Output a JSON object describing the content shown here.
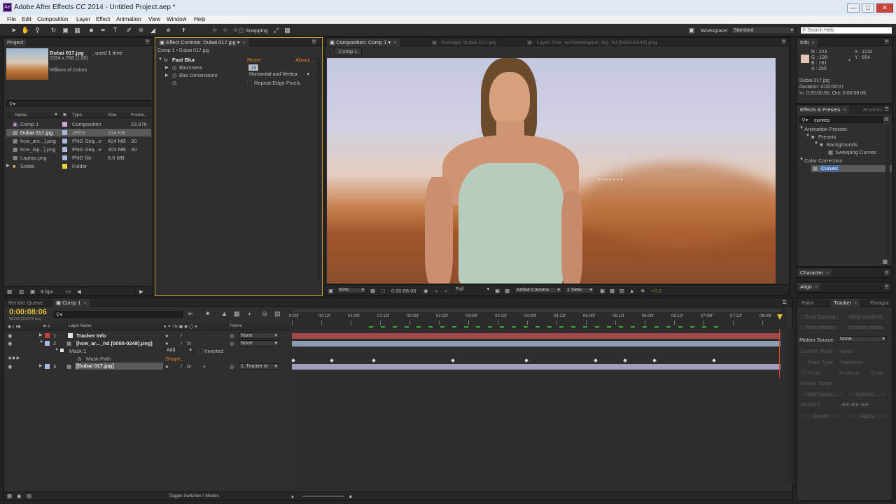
{
  "window": {
    "title": "Adobe After Effects CC 2014 - Untitled Project.aep *",
    "minimize": "—",
    "maximize": "□",
    "close": "✕"
  },
  "menu": [
    "File",
    "Edit",
    "Composition",
    "Layer",
    "Effect",
    "Animation",
    "View",
    "Window",
    "Help"
  ],
  "toolbar": {
    "snapping": "Snapping",
    "workspace_label": "Workspace:",
    "workspace_value": "Standard",
    "search_placeholder": "Search Help"
  },
  "project": {
    "tab": "Project",
    "selected_name": "Dubai 017.jpg",
    "selected_used": ", used 1 time",
    "selected_dims": "1024 x 768 (1.00)",
    "selected_colors": "Millions of Colors",
    "columns": [
      "Name",
      "Type",
      "Size",
      "Frame..."
    ],
    "items": [
      {
        "name": "Comp 1",
        "type": "Composition",
        "size": "",
        "frame": "23.976"
      },
      {
        "name": "Dubai 017.jpg",
        "type": "JPEG",
        "size": "134 KB",
        "frame": ""
      },
      {
        "name": "hcw_arc...].png",
        "type": "PNG Seq...e",
        "size": "424 MB",
        "frame": "30"
      },
      {
        "name": "hcw_lap...].png",
        "type": "PNG Seq...e",
        "size": "303 MB",
        "frame": "30"
      },
      {
        "name": "Laptop.png",
        "type": "PNG file",
        "size": "6.6 MB",
        "frame": ""
      },
      {
        "name": "Solids",
        "type": "Folder",
        "size": "",
        "frame": ""
      }
    ],
    "bpc": "8 bpc"
  },
  "effect_controls": {
    "tab": "Effect Controls: Dubai 017.jpg",
    "breadcrumb": "Comp 1 • Dubai 017.jpg",
    "fx_label": "fx",
    "effect_name": "Fast Blur",
    "reset": "Reset",
    "about": "About...",
    "blurriness_label": "Blurriness",
    "blurriness_value": "18",
    "dimensions_label": "Blur Dimensions",
    "dimensions_value": "Horizontal and Vertica",
    "repeat_edge": "Repeat Edge Pixels"
  },
  "composition": {
    "tab": "Composition: Comp 1",
    "footage_tab": "Footage: Dubai 017.jpg",
    "layer_tab": "Layer: hcw_archaeological_dig_hd.[0000-0248].png",
    "subtab": "Comp 1",
    "zoom": "50%",
    "timecode": "0:00:08:06",
    "resolution": "Full",
    "camera": "Active Camera",
    "views": "1 View",
    "exposure": "+0.0"
  },
  "info": {
    "tab": "Info",
    "r": "R : 223",
    "g": "G : 198",
    "b": "B : 181",
    "a": "A : 255",
    "x": "X : 1132",
    "y": "Y : 654",
    "file": "Dubai 017.jpg",
    "duration": "Duration: 0:00:08:07",
    "inout": "In: 0:00:00:00, Out: 0:00:08:06",
    "swatch": "#dfc6b5"
  },
  "effects_presets": {
    "tab": "Effects & Presets",
    "brushes_tab": "Brushes",
    "search": "curves",
    "tree": [
      "Animation Presets",
      "Presets",
      "Backgrounds",
      "Sweeping Curves",
      "Color Correction",
      "Curves"
    ]
  },
  "character": {
    "tab": "Character",
    "align_tab": "Align"
  },
  "tracker": {
    "paint_tab": "Paint",
    "tab": "Tracker",
    "paragraph_tab": "Paragra",
    "track_camera": "Track Camera",
    "warp_stabilizer": "Warp Stabilizer",
    "track_motion": "Track Motion",
    "stabilize_motion": "Stabilize Motion",
    "motion_source_label": "Motion Source:",
    "motion_source_value": "None",
    "current_track_label": "Current Track:",
    "current_track_value": "None",
    "track_type_label": "Track Type:",
    "track_type_value": "Transform",
    "position": "Positi",
    "rotation": "Rotation",
    "scale": "Scale",
    "motion_target": "Motion Target:",
    "edit_target": "Edit Target...",
    "options": "Options...",
    "analyze": "Analyze:",
    "reset": "Reset",
    "apply": "Apply"
  },
  "timeline": {
    "render_queue_tab": "Render Queue",
    "comp_tab": "Comp 1",
    "timecode": "0:00:08:06",
    "fps": "00198 (23.976 fps)",
    "layer_name_col": "Layer Name",
    "parent_col": "Parent",
    "rulers": [
      "0:00f",
      "00:12f",
      "01:00f",
      "01:12f",
      "02:00f",
      "02:12f",
      "03:00f",
      "03:12f",
      "04:00f",
      "04:12f",
      "05:00f",
      "05:12f",
      "06:00f",
      "06:12f",
      "07:00f",
      "07:12f",
      "08:00f"
    ],
    "layers": [
      {
        "num": "1",
        "name": "Tracker Info",
        "parent": "None"
      },
      {
        "num": "2",
        "name": "[hcw_ar..._hd.[0000-0248].png]",
        "parent": "None"
      },
      {
        "num": "3",
        "name": "[Dubai 017.jpg]",
        "parent": "1. Tracker In"
      }
    ],
    "mask_name": "Mask 1",
    "mask_mode": "Add",
    "mask_inverted": "Inverted",
    "mask_path": "Mask Path",
    "mask_path_value": "Shape...",
    "toggle": "Toggle Switches / Modes"
  }
}
